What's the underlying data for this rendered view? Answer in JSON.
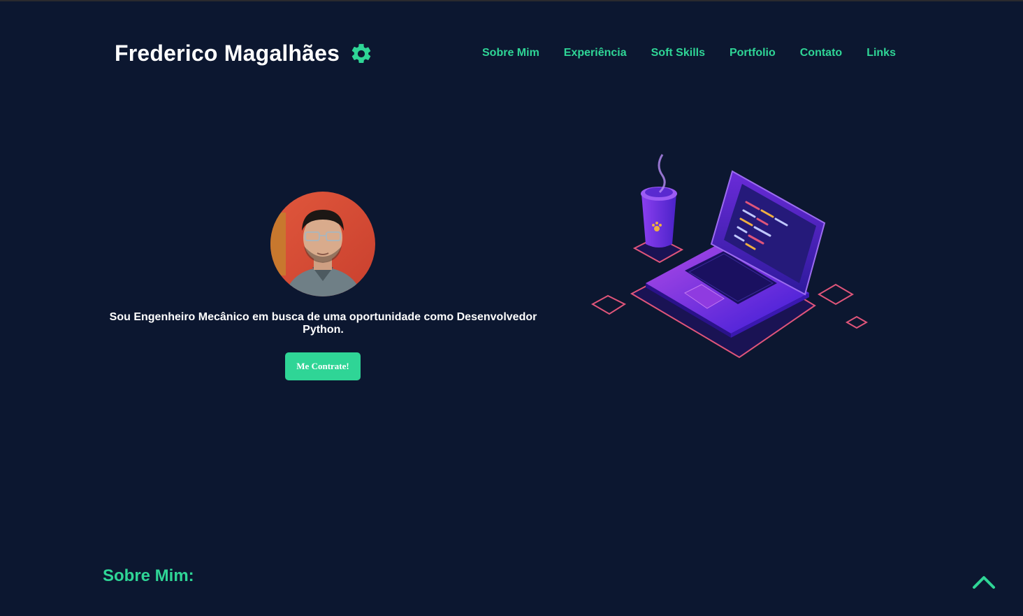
{
  "header": {
    "brand_name": "Frederico Magalhães",
    "brand_icon": "gear-icon"
  },
  "nav": {
    "items": [
      {
        "label": "Sobre Mim"
      },
      {
        "label": "Experiência"
      },
      {
        "label": "Soft Skills"
      },
      {
        "label": "Portfolio"
      },
      {
        "label": "Contato"
      },
      {
        "label": "Links"
      }
    ]
  },
  "hero": {
    "intro": "Sou Engenheiro Mecânico em busca de uma oportunidade como Desenvolvedor Python.",
    "cta_label": "Me Contrate!"
  },
  "sections": {
    "about_title": "Sobre Mim:"
  },
  "icons": {
    "back_to_top": "chevron-up-icon"
  },
  "colors": {
    "background": "#0c1730",
    "accent": "#2fd596",
    "text": "#ffffff"
  }
}
